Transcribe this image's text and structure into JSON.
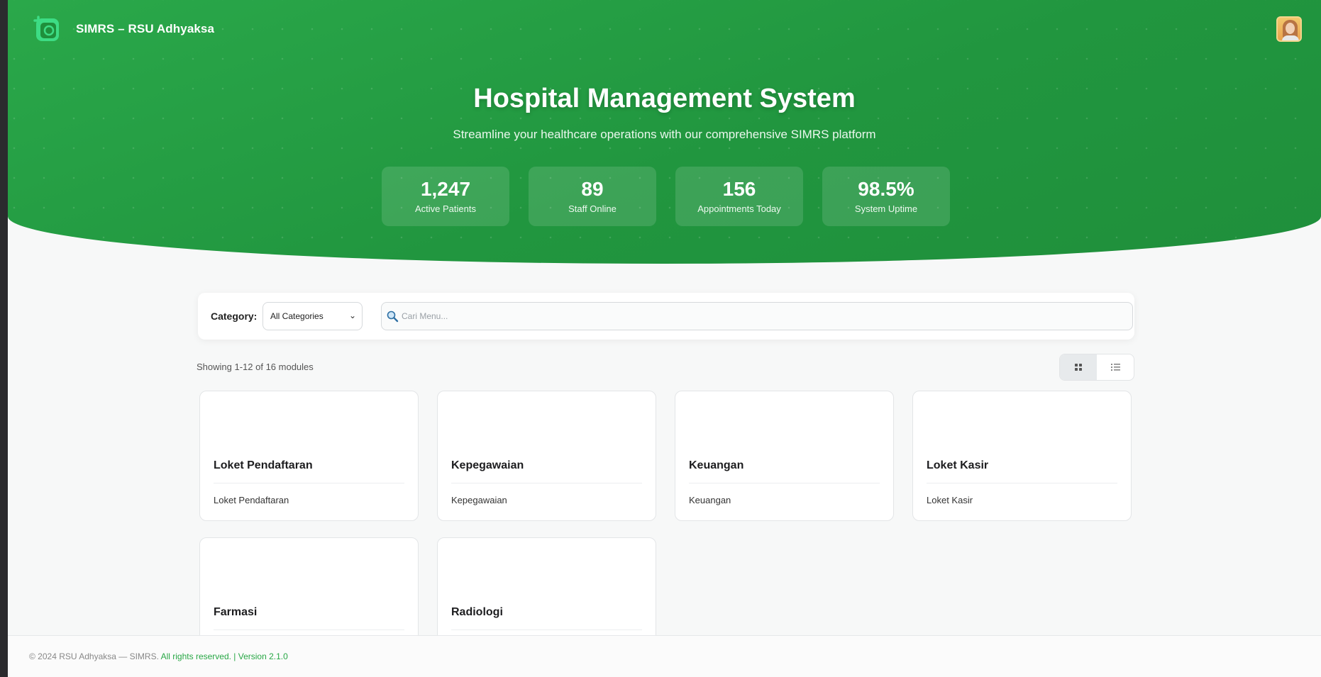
{
  "header": {
    "brand": "SIMRS – RSU Adhyaksa",
    "logo_icon": "medical-cross-logo-icon",
    "avatar_icon": "user-avatar-icon"
  },
  "hero": {
    "title": "Hospital Management System",
    "subtitle": "Streamline your healthcare operations with our comprehensive SIMRS platform",
    "stats": [
      {
        "value": "1,247",
        "label": "Active Patients"
      },
      {
        "value": "89",
        "label": "Staff Online"
      },
      {
        "value": "156",
        "label": "Appointments Today"
      },
      {
        "value": "98.5%",
        "label": "System Uptime"
      }
    ]
  },
  "filter": {
    "category_label": "Category:",
    "category_selected": "All Categories",
    "search_placeholder": "Cari Menu...",
    "search_value": ""
  },
  "results": {
    "showing_text": "Showing 1-12 of 16 modules",
    "view_modes": [
      "grid",
      "list"
    ],
    "active_view": "grid"
  },
  "modules": [
    {
      "title": "Loket Pendaftaran",
      "description": "Loket Pendaftaran"
    },
    {
      "title": "Kepegawaian",
      "description": "Kepegawaian"
    },
    {
      "title": "Keuangan",
      "description": "Keuangan"
    },
    {
      "title": "Loket Kasir",
      "description": "Loket Kasir"
    },
    {
      "title": "Farmasi",
      "description": ""
    },
    {
      "title": "Radiologi",
      "description": ""
    }
  ],
  "footer": {
    "copyright": "© 2024 RSU Adhyaksa — SIMRS.",
    "rights": " All rights reserved. | Version 2.1.0"
  },
  "colors": {
    "primary": "#28a745",
    "hero_dark": "#1f8f3b"
  }
}
